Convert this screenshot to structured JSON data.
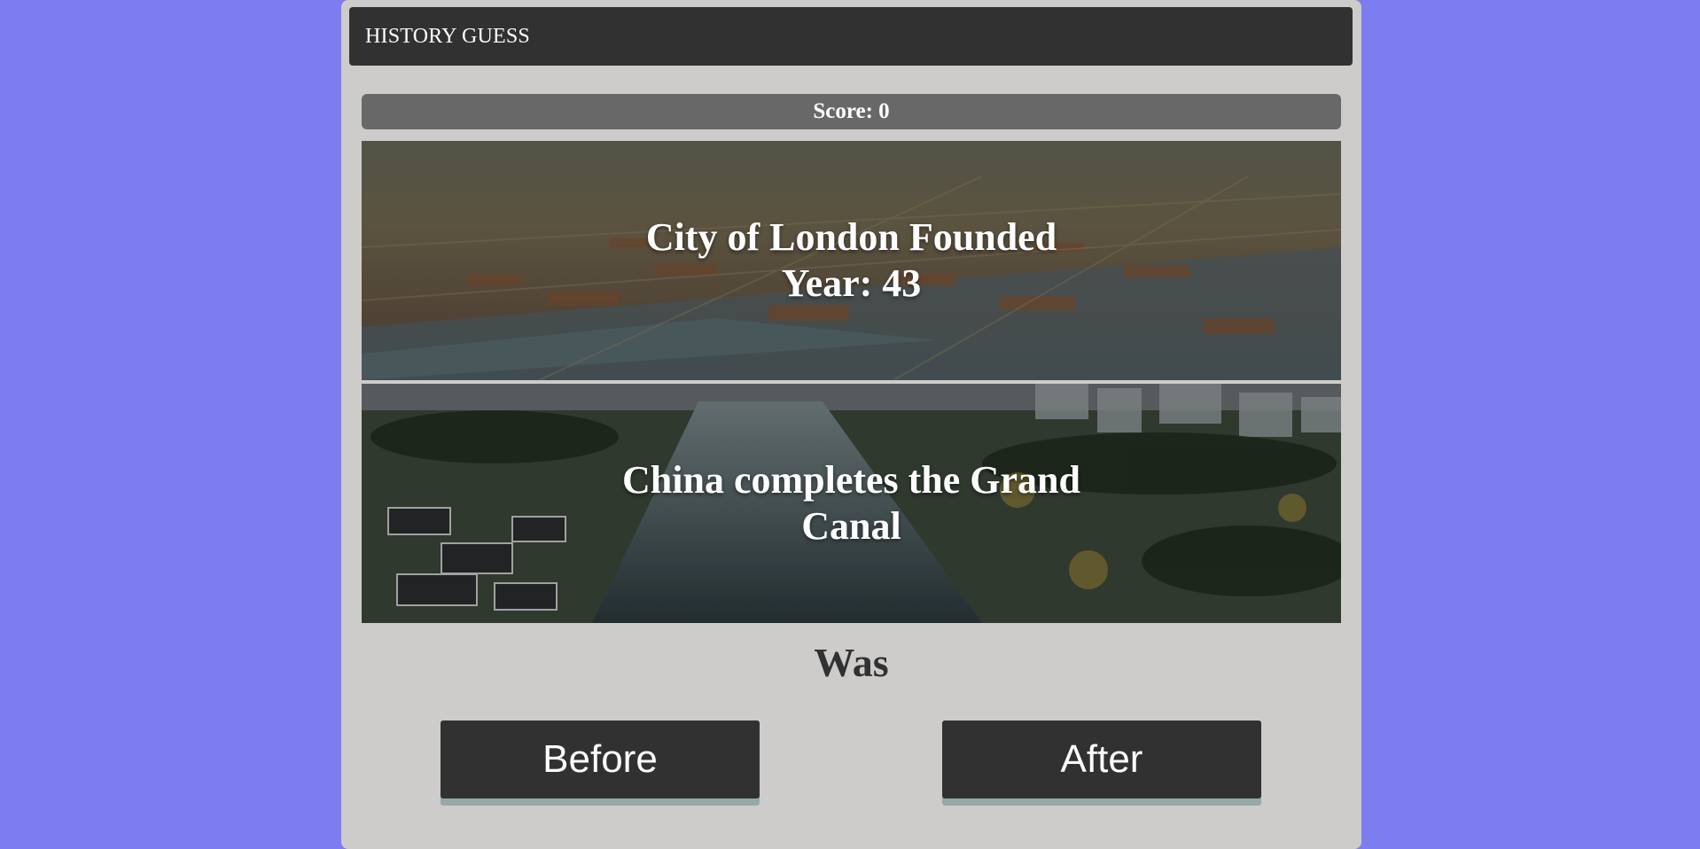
{
  "header": {
    "title": "HISTORY GUESS"
  },
  "score": {
    "label": "Score: 0"
  },
  "cards": [
    {
      "title": "City of London Founded",
      "year_label": "Year: 43"
    },
    {
      "title": "China completes the Grand Canal"
    }
  ],
  "prompt": {
    "text": "Was"
  },
  "buttons": {
    "before_label": "Before",
    "after_label": "After"
  },
  "colors": {
    "page_background": "#7d7df0",
    "panel_background": "#cdccca",
    "header_background": "#313131",
    "score_background": "#686868",
    "button_background": "#313131",
    "button_shadow": "#95aaa8"
  }
}
